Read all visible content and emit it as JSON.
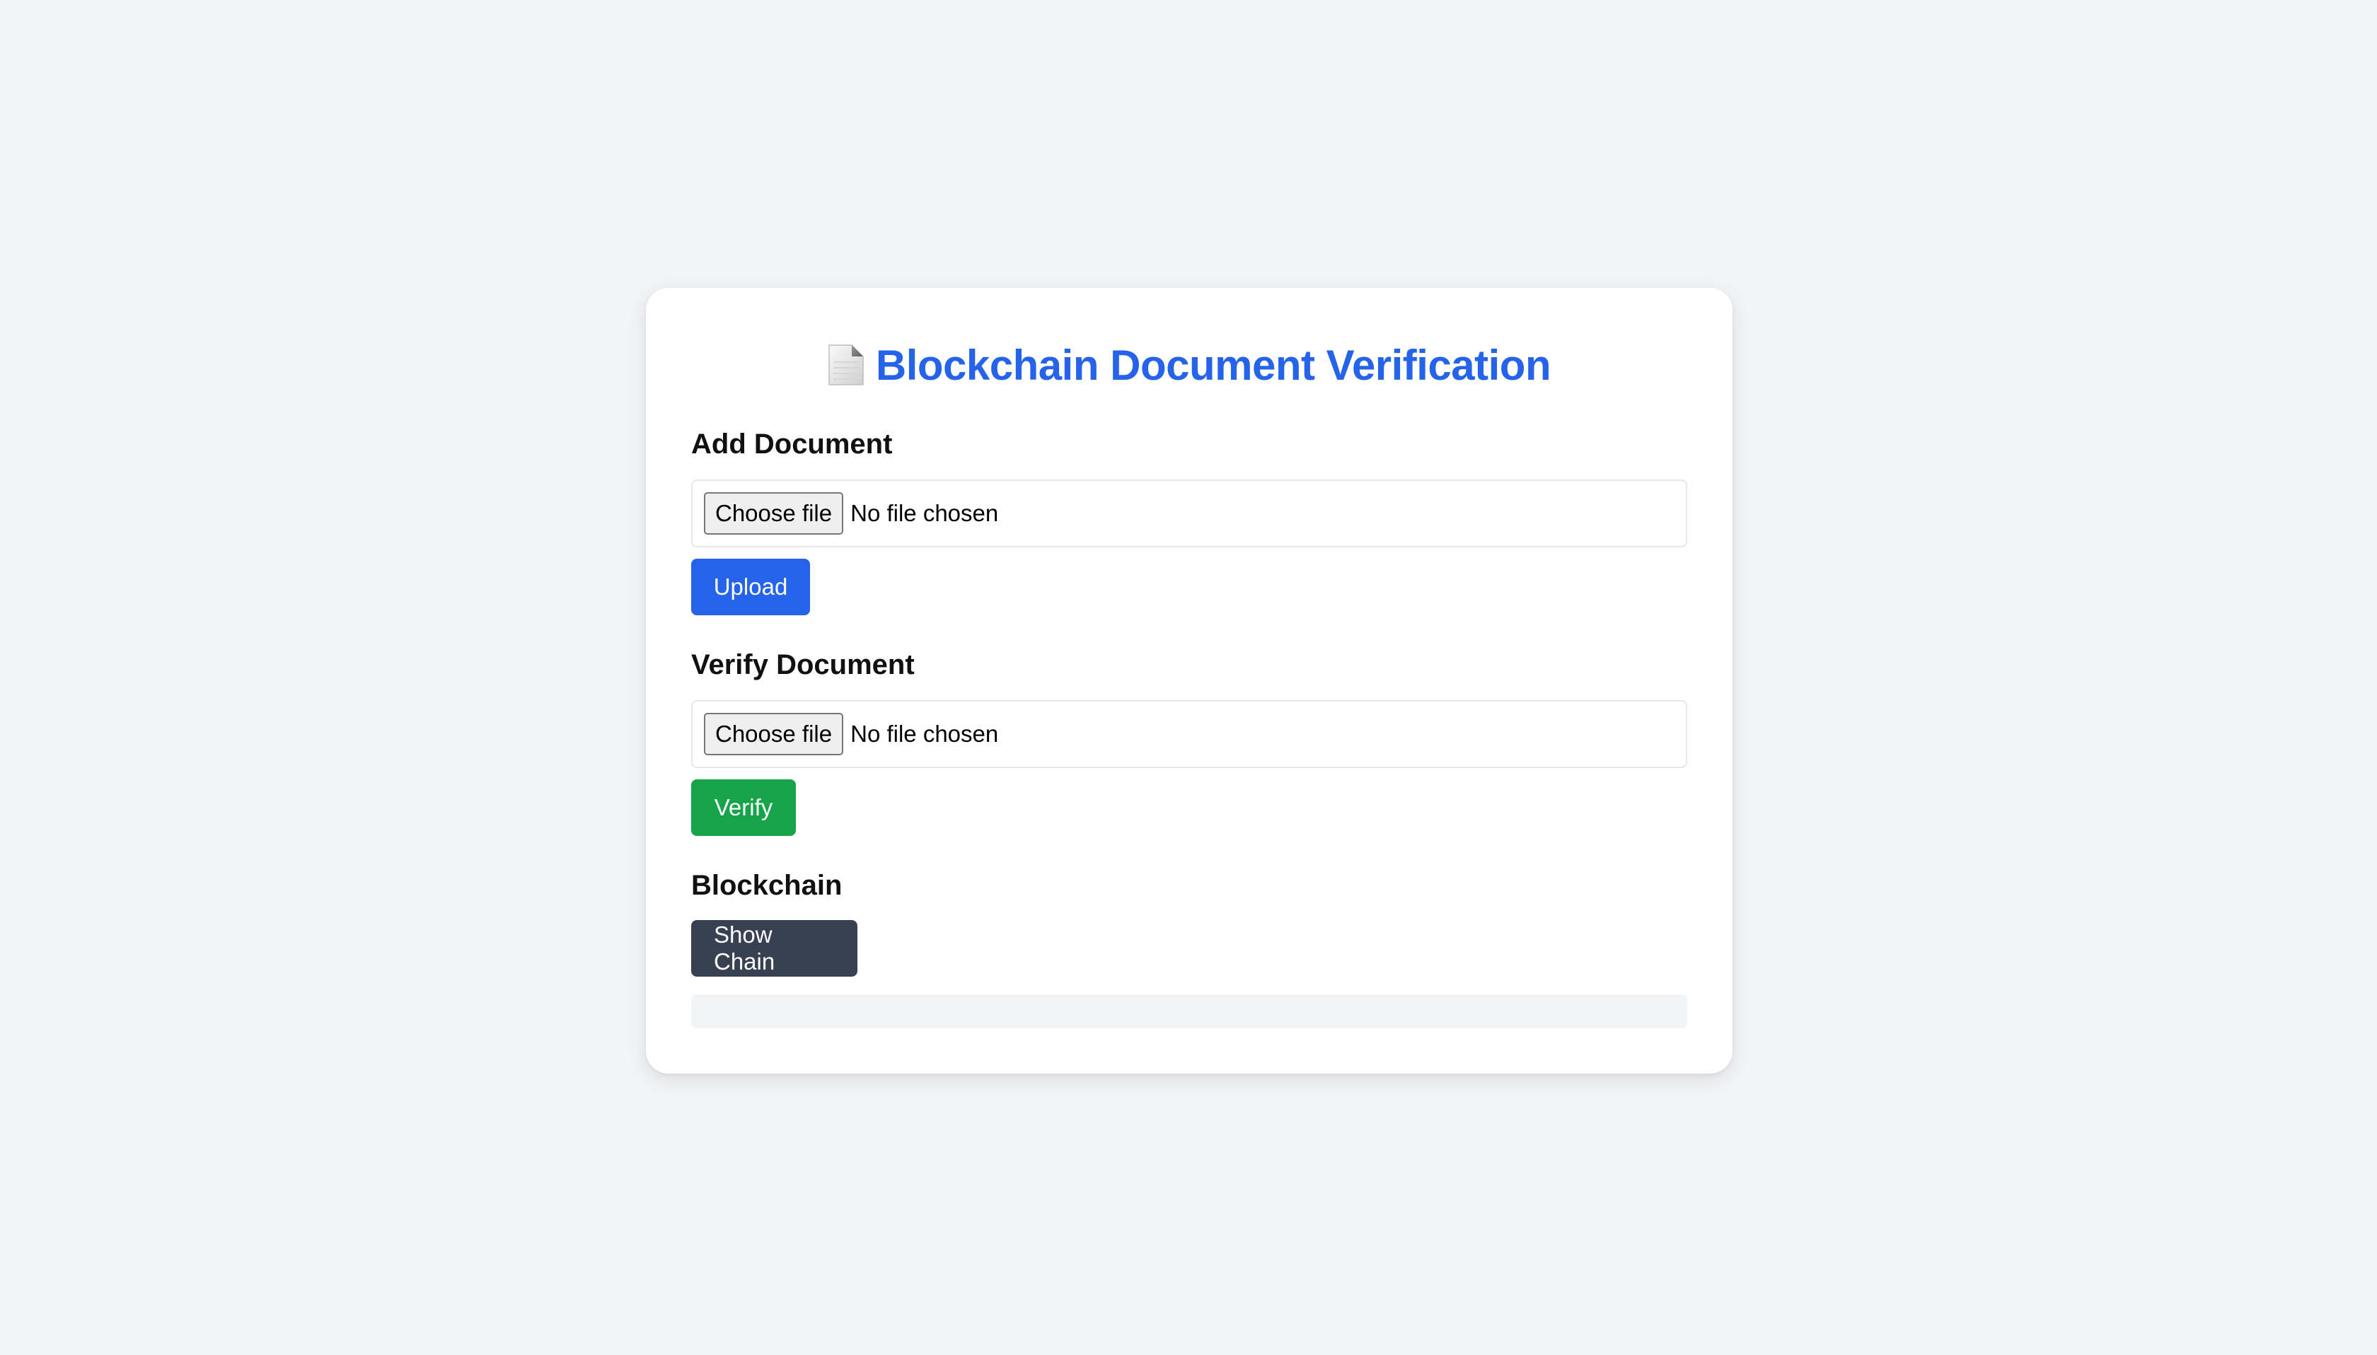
{
  "page": {
    "title": "Blockchain Document Verification",
    "title_icon": "document-icon"
  },
  "add_section": {
    "heading": "Add Document",
    "file_button_label": "Choose file",
    "file_status": "No file chosen",
    "submit_label": "Upload"
  },
  "verify_section": {
    "heading": "Verify Document",
    "file_button_label": "Choose file",
    "file_status": "No file chosen",
    "submit_label": "Verify"
  },
  "chain_section": {
    "heading": "Blockchain",
    "show_label": "Show Chain",
    "output": ""
  },
  "colors": {
    "background": "#f3f4f6",
    "accent": "#2563eb",
    "upload_button": "#2563eb",
    "verify_button": "#16a34a",
    "chain_button": "#374151"
  }
}
